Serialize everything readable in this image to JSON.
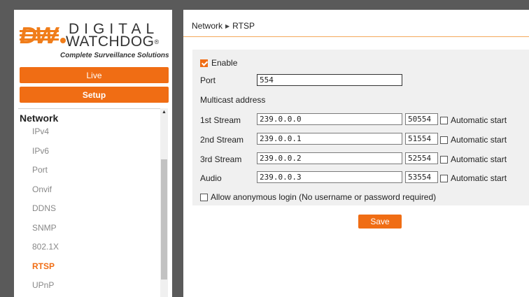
{
  "logo": {
    "mark": "DW",
    "brand_top": "DIGITAL",
    "brand_bottom": "WATCHDOG",
    "registered": "®",
    "tagline": "Complete Surveillance Solutions"
  },
  "colors": {
    "accent": "#f06d14",
    "panel_bg": "#f0f0f0",
    "frame_bg": "#5a5a5a"
  },
  "menu": {
    "live_label": "Live",
    "setup_label": "Setup"
  },
  "nav": {
    "section_title": "Network",
    "items": [
      {
        "label": "IPv4",
        "active": false
      },
      {
        "label": "IPv6",
        "active": false
      },
      {
        "label": "Port",
        "active": false
      },
      {
        "label": "Onvif",
        "active": false
      },
      {
        "label": "DDNS",
        "active": false
      },
      {
        "label": "SNMP",
        "active": false
      },
      {
        "label": "802.1X",
        "active": false
      },
      {
        "label": "RTSP",
        "active": true
      },
      {
        "label": "UPnP",
        "active": false
      }
    ]
  },
  "breadcrumb": {
    "parent": "Network",
    "separator": "▶",
    "current": "RTSP"
  },
  "form": {
    "enable_label": "Enable",
    "enable_checked": true,
    "port_label": "Port",
    "port_value": "554",
    "multicast_label": "Multicast address",
    "streams": [
      {
        "label": "1st Stream",
        "address": "239.0.0.0",
        "port": "50554",
        "auto_label": "Automatic start",
        "auto_checked": false
      },
      {
        "label": "2nd Stream",
        "address": "239.0.0.1",
        "port": "51554",
        "auto_label": "Automatic start",
        "auto_checked": false
      },
      {
        "label": "3rd Stream",
        "address": "239.0.0.2",
        "port": "52554",
        "auto_label": "Automatic start",
        "auto_checked": false
      },
      {
        "label": "Audio",
        "address": "239.0.0.3",
        "port": "53554",
        "auto_label": "Automatic start",
        "auto_checked": false
      }
    ],
    "anonymous_label": "Allow anonymous login (No username or password required)",
    "anonymous_checked": false,
    "save_label": "Save"
  }
}
